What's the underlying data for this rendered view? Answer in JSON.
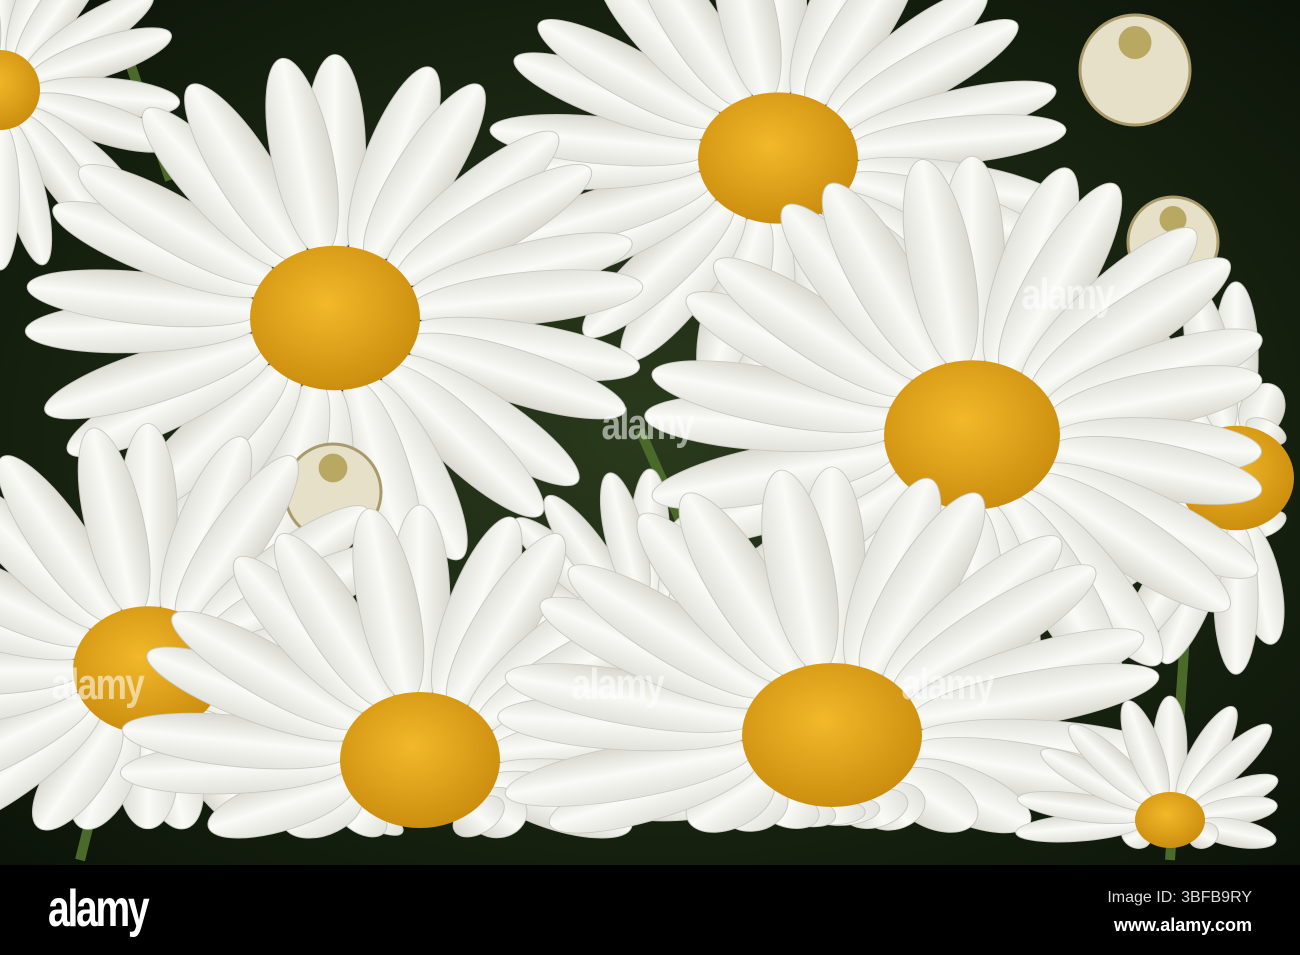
{
  "watermark": "alamy",
  "footer": {
    "logo": "alamy",
    "image_id": "Image ID: 3BFB9RY",
    "website": "www.alamy.com"
  },
  "colors": {
    "background": "#14200f",
    "petal": "#f4f4f0",
    "disc": "#e8a818",
    "bar": "#000000"
  }
}
